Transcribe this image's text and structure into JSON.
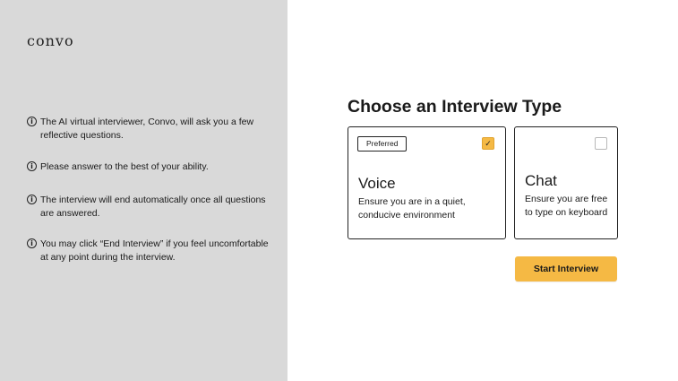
{
  "brand": {
    "logo_text": "convo"
  },
  "instructions": [
    {
      "icon": "info-icon",
      "text": "The AI virtual interviewer, Convo, will ask you a few reflective questions."
    },
    {
      "icon": "info-icon",
      "text": "Please answer to the best of your ability."
    },
    {
      "icon": "info-icon",
      "text": "The interview will end automatically once all questions are answered."
    },
    {
      "icon": "info-icon",
      "text": "You may click “End Interview” if you feel uncomfortable at any point during the interview."
    }
  ],
  "main": {
    "heading": "Choose an Interview Type",
    "options": [
      {
        "badge": "Preferred",
        "title": "Voice",
        "description": "Ensure you are in a quiet, conducive environment",
        "selected": true
      },
      {
        "badge": "",
        "title": "Chat",
        "description": "Ensure you are free to type on keyboard",
        "selected": false
      }
    ],
    "start_button": "Start Interview"
  },
  "colors": {
    "left_panel": "#d9d9d9",
    "accent": "#f5b944",
    "background": "#ffffff"
  }
}
